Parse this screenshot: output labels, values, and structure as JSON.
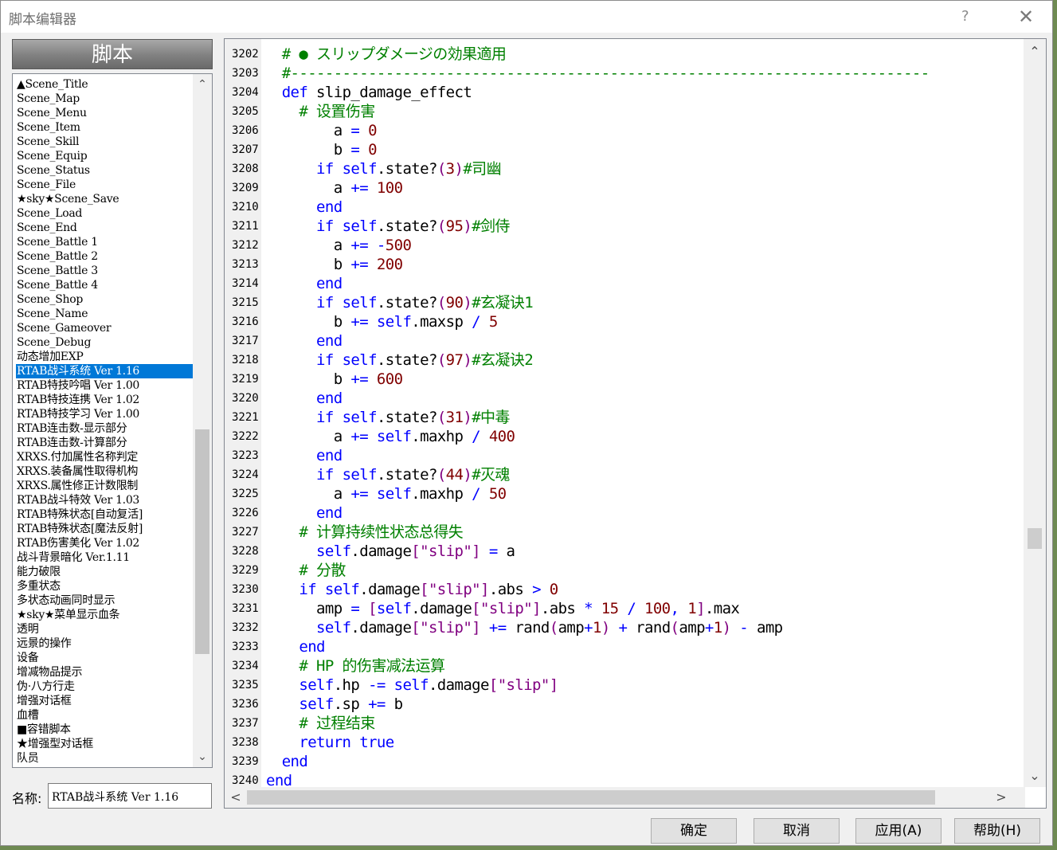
{
  "window": {
    "title": "脚本编辑器",
    "help_glyph": "?",
    "close_glyph": "✕"
  },
  "left_panel": {
    "header": "脚本",
    "scripts": [
      "▲Scene_Title",
      "Scene_Map",
      "Scene_Menu",
      "Scene_Item",
      "Scene_Skill",
      "Scene_Equip",
      "Scene_Status",
      "Scene_File",
      "★sky★Scene_Save",
      "Scene_Load",
      "Scene_End",
      "Scene_Battle 1",
      "Scene_Battle 2",
      "Scene_Battle 3",
      "Scene_Battle 4",
      "Scene_Shop",
      "Scene_Name",
      "Scene_Gameover",
      "Scene_Debug",
      "动态增加EXP",
      "RTAB战斗系统 Ver 1.16",
      "RTAB特技吟唱 Ver 1.00",
      "RTAB特技连携 Ver 1.02",
      "RTAB特技学习 Ver 1.00",
      "RTAB连击数-显示部分",
      "RTAB连击数-计算部分",
      "XRXS.付加属性名称判定",
      "XRXS.装备属性取得机构",
      "XRXS.属性修正计数限制",
      "RTAB战斗特效 Ver 1.03",
      "RTAB特殊状态[自动复活]",
      "RTAB特殊状态[魔法反射]",
      "RTAB伤害美化 Ver 1.02",
      "战斗背景暗化 Ver.1.11",
      "能力破限",
      "多重状态",
      "多状态动画同时显示",
      "★sky★菜单显示血条",
      "透明",
      "远景的操作",
      "设备",
      "增减物品提示",
      "伪·八方行走",
      "增强对话框",
      "血槽",
      "■容错脚本",
      "★增强型对话框",
      "队员"
    ],
    "selected_index": 20,
    "name_label": "名称:",
    "name_value": "RTAB战斗系统 Ver 1.16"
  },
  "editor": {
    "line_numbers": [
      "3202",
      "3203",
      "3204",
      "3205",
      "3206",
      "3207",
      "3208",
      "3209",
      "3210",
      "3211",
      "3212",
      "3213",
      "3214",
      "3215",
      "3216",
      "3217",
      "3218",
      "3219",
      "3220",
      "3221",
      "3222",
      "3223",
      "3224",
      "3225",
      "3226",
      "3227",
      "3228",
      "3229",
      "3230",
      "3231",
      "3232",
      "3233",
      "3234",
      "3235",
      "3236",
      "3237",
      "3238",
      "3239",
      "3240"
    ],
    "code_lines": [
      "  # ● スリップダメージの効果適用",
      "  #--------------------------------------------------------------------------",
      "  def slip_damage_effect",
      "    # 设置伤害",
      "        a = 0",
      "        b = 0",
      "      if self.state?(3)#司幽",
      "        a += 100",
      "      end",
      "      if self.state?(95)#剑侍",
      "        a += -500",
      "        b += 200",
      "      end",
      "      if self.state?(90)#玄凝诀1",
      "        b += self.maxsp / 5",
      "      end",
      "      if self.state?(97)#玄凝诀2",
      "        b += 600",
      "      end",
      "      if self.state?(31)#中毒",
      "        a += self.maxhp / 400",
      "      end",
      "      if self.state?(44)#灭魂",
      "        a += self.maxhp / 50",
      "      end",
      "    # 计算持续性状态总得失",
      "      self.damage[\"slip\"] = a",
      "    # 分散",
      "    if self.damage[\"slip\"].abs > 0",
      "      amp = [self.damage[\"slip\"].abs * 15 / 100, 1].max",
      "      self.damage[\"slip\"] += rand(amp+1) + rand(amp+1) - amp",
      "    end",
      "    # HP 的伤害减法运算",
      "    self.hp -= self.damage[\"slip\"]",
      "    self.sp += b",
      "    # 过程结束",
      "    return true",
      "  end",
      "end"
    ]
  },
  "buttons": {
    "ok": "确定",
    "cancel": "取消",
    "apply": "应用(A)",
    "help": "帮助(H)"
  },
  "scroll_glyphs": {
    "up": "⌃",
    "down": "⌄",
    "left": "<",
    "right": ">"
  },
  "colors": {
    "selection": "#0078d7",
    "comment": "#008000",
    "keyword": "#0000ff",
    "number": "#800000",
    "string": "#800080"
  }
}
